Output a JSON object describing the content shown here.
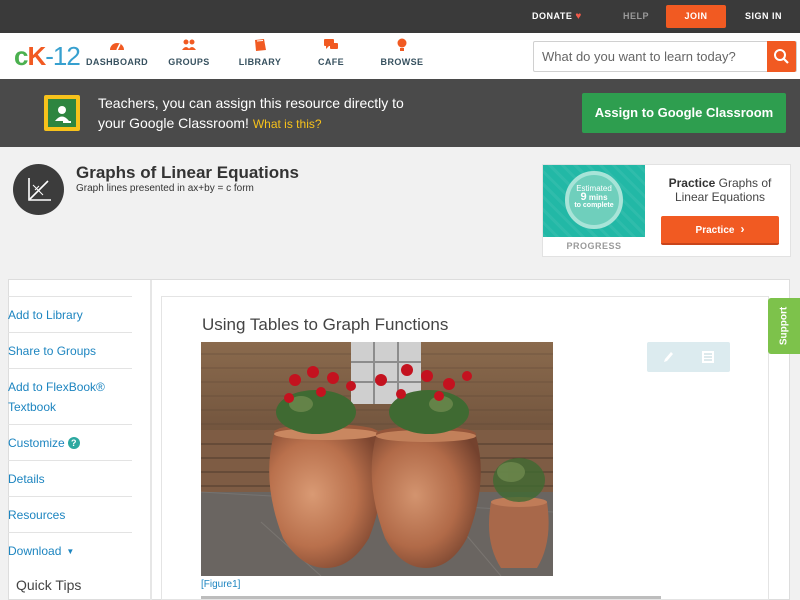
{
  "topbar": {
    "donate": "DONATE",
    "help": "HELP",
    "join": "JOIN",
    "signin": "SIGN IN"
  },
  "nav": {
    "logo": {
      "c": "c",
      "k": "K",
      "n": "-12"
    },
    "items": [
      {
        "label": "DASHBOARD",
        "icon": "dashboard-icon"
      },
      {
        "label": "GROUPS",
        "icon": "groups-icon"
      },
      {
        "label": "LIBRARY",
        "icon": "library-icon"
      },
      {
        "label": "CAFE",
        "icon": "cafe-icon"
      },
      {
        "label": "BROWSE",
        "icon": "browse-icon"
      }
    ],
    "search_placeholder": "What do you want to learn today?"
  },
  "banner": {
    "line1": "Teachers, you can assign this resource directly to",
    "line2": "your Google Classroom!",
    "what": "What is this?",
    "assign_button": "Assign to Google Classroom"
  },
  "concept": {
    "title": "Graphs of Linear Equations",
    "subtitle": "Graph lines presented in ax+by = c form"
  },
  "practice_card": {
    "estimated": "Estimated",
    "mins_num": "9",
    "mins_word": "mins",
    "to_complete": "to complete",
    "progress_label": "PROGRESS",
    "title_bold": "Practice",
    "title_rest": "Graphs of Linear Equations",
    "button": "Practice"
  },
  "sidebar": {
    "items": [
      {
        "label": "Add to Library"
      },
      {
        "label": "Share to Groups"
      },
      {
        "label": "Add to FlexBook®"
      },
      {
        "label": "Textbook"
      },
      {
        "label": "Customize"
      },
      {
        "label": "Details"
      },
      {
        "label": "Resources"
      },
      {
        "label": "Download"
      }
    ],
    "quick_tips": "Quick Tips"
  },
  "article": {
    "title": "Using Tables to Graph Functions",
    "figure_link": "[Figure1]"
  },
  "support": "Support",
  "colors": {
    "accent": "#f15a22",
    "green": "#2e9e4f",
    "teal": "#22b8a6",
    "link": "#1d85c0"
  }
}
